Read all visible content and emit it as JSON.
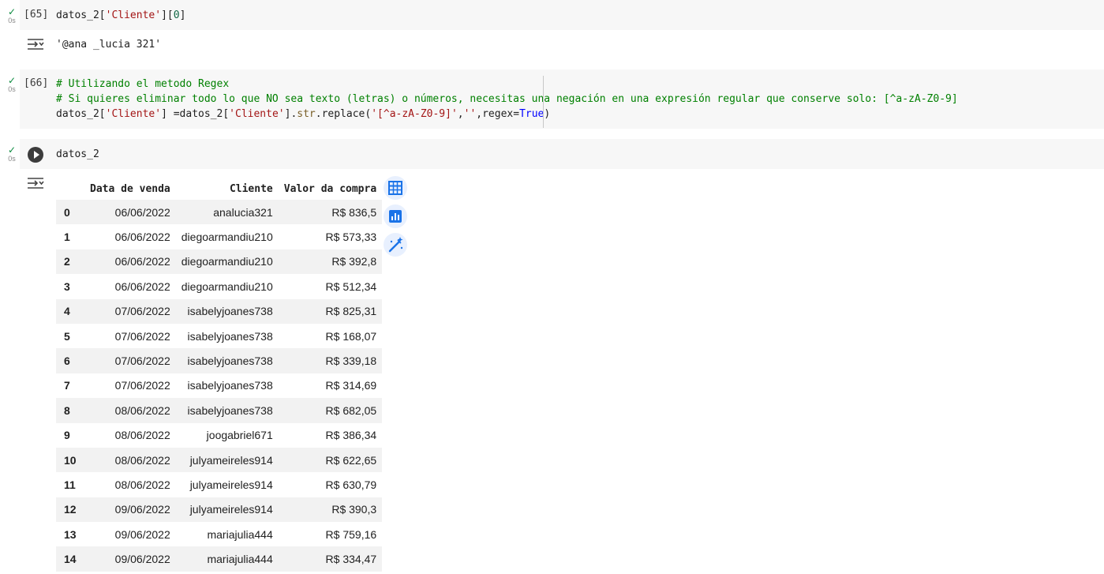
{
  "cells": [
    {
      "status_time": "0s",
      "prompt": "[65]",
      "code_tokens": [
        {
          "t": "datos_2[",
          "c": ""
        },
        {
          "t": "'Cliente'",
          "c": "c-str"
        },
        {
          "t": "][",
          "c": ""
        },
        {
          "t": "0",
          "c": "c-num"
        },
        {
          "t": "]",
          "c": ""
        }
      ],
      "output_text": "'@ana _lucia 321'"
    },
    {
      "status_time": "0s",
      "prompt": "[66]",
      "code_lines": [
        [
          {
            "t": "# Utilizando el metodo Regex",
            "c": "c-com"
          }
        ],
        [
          {
            "t": "# Si quieres eliminar todo lo que NO sea texto (letras) o números, necesitas una negación en una expresión regular que conserve solo: [^a-zA-Z0-9]",
            "c": "c-com"
          }
        ],
        [
          {
            "t": "datos_2[",
            "c": ""
          },
          {
            "t": "'Cliente'",
            "c": "c-str"
          },
          {
            "t": "] =datos_2[",
            "c": ""
          },
          {
            "t": "'Cliente'",
            "c": "c-str"
          },
          {
            "t": "].",
            "c": ""
          },
          {
            "t": "str",
            "c": "c-attr"
          },
          {
            "t": ".replace(",
            "c": ""
          },
          {
            "t": "'[^a-zA-Z0-9]'",
            "c": "c-str"
          },
          {
            "t": ",",
            "c": ""
          },
          {
            "t": "''",
            "c": "c-str"
          },
          {
            "t": ",regex=",
            "c": ""
          },
          {
            "t": "True",
            "c": "c-kw"
          },
          {
            "t": ")",
            "c": ""
          }
        ]
      ]
    },
    {
      "status_time": "0s",
      "code": "datos_2"
    }
  ],
  "dataframe": {
    "columns": [
      "",
      "Data de venda",
      "Cliente",
      "Valor da compra"
    ],
    "rows": [
      [
        "0",
        "06/06/2022",
        "analucia321",
        "R$ 836,5"
      ],
      [
        "1",
        "06/06/2022",
        "diegoarmandiu210",
        "R$ 573,33"
      ],
      [
        "2",
        "06/06/2022",
        "diegoarmandiu210",
        "R$ 392,8"
      ],
      [
        "3",
        "06/06/2022",
        "diegoarmandiu210",
        "R$ 512,34"
      ],
      [
        "4",
        "07/06/2022",
        "isabelyjoanes738",
        "R$ 825,31"
      ],
      [
        "5",
        "07/06/2022",
        "isabelyjoanes738",
        "R$ 168,07"
      ],
      [
        "6",
        "07/06/2022",
        "isabelyjoanes738",
        "R$ 339,18"
      ],
      [
        "7",
        "07/06/2022",
        "isabelyjoanes738",
        "R$ 314,69"
      ],
      [
        "8",
        "08/06/2022",
        "isabelyjoanes738",
        "R$ 682,05"
      ],
      [
        "9",
        "08/06/2022",
        "joogabriel671",
        "R$ 386,34"
      ],
      [
        "10",
        "08/06/2022",
        "julyameireles914",
        "R$ 622,65"
      ],
      [
        "11",
        "08/06/2022",
        "julyameireles914",
        "R$ 630,79"
      ],
      [
        "12",
        "09/06/2022",
        "julyameireles914",
        "R$ 390,3"
      ],
      [
        "13",
        "09/06/2022",
        "mariajulia444",
        "R$ 759,16"
      ],
      [
        "14",
        "09/06/2022",
        "mariajulia444",
        "R$ 334,47"
      ]
    ]
  },
  "side_actions": [
    {
      "icon": "table-icon"
    },
    {
      "icon": "chart-icon"
    },
    {
      "icon": "magic-wand-icon"
    }
  ],
  "colors": {
    "success": "#0a8a3e",
    "accent": "#1a73e8",
    "cell_bg": "#f7f7f7"
  }
}
